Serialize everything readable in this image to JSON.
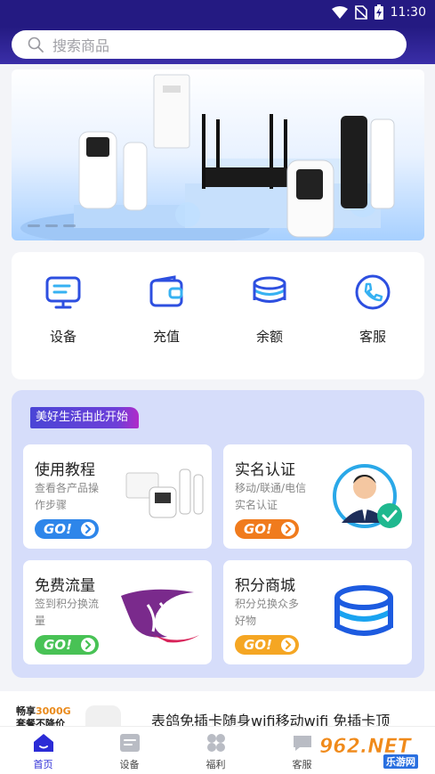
{
  "status_bar": {
    "time": "11:30"
  },
  "search": {
    "placeholder": "搜索商品"
  },
  "quick_actions": [
    {
      "label": "设备",
      "icon": "monitor-icon"
    },
    {
      "label": "充值",
      "icon": "wallet-icon"
    },
    {
      "label": "余额",
      "icon": "coins-stack-icon"
    },
    {
      "label": "客服",
      "icon": "phone-icon"
    }
  ],
  "promo": {
    "tag": "美好生活由此开始",
    "cards": [
      {
        "title": "使用教程",
        "subtitle": "查看各产品操作步骤",
        "go": "GO!",
        "go_color": "#2e86ea"
      },
      {
        "title": "实名认证",
        "subtitle": "移动/联通/电信实名认证",
        "go": "GO!",
        "go_color": "#f07b1d"
      },
      {
        "title": "免费流量",
        "subtitle": "签到积分换流量",
        "go": "GO!",
        "go_color": "#48c255"
      },
      {
        "title": "积分商城",
        "subtitle": "积分兑换众多好物",
        "go": "GO!",
        "go_color": "#f5a623"
      }
    ]
  },
  "product": {
    "badge_prefix": "畅享",
    "badge_highlight": "3000G",
    "badge_line2": "套餐不降价",
    "title": "表鸽免插卡随身wifi移动wifi 免插卡顶"
  },
  "tabbar": [
    {
      "label": "首页",
      "icon": "home-icon",
      "active": true
    },
    {
      "label": "设备",
      "icon": "device-icon",
      "active": false
    },
    {
      "label": "福利",
      "icon": "grid-icon",
      "active": false
    },
    {
      "label": "客服",
      "icon": "chat-icon",
      "active": false
    }
  ],
  "watermark": {
    "brand": "962.NET",
    "text": "乐游网"
  },
  "colors": {
    "header": "#241a82",
    "accent": "#2b2bd6",
    "promo_bg": "#d6ddfa"
  }
}
